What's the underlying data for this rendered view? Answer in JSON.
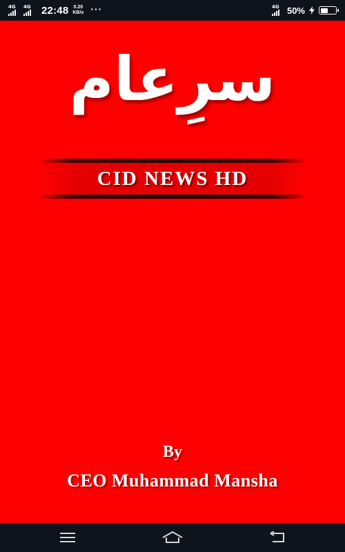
{
  "status_bar": {
    "network1": "4G",
    "network2": "4G",
    "time": "22:48",
    "speed_value": "0.20",
    "speed_unit": "KB/s",
    "more_dots": "···",
    "network3": "4G",
    "battery_percent": "50%",
    "battery_level": 0.5,
    "icons": [
      "signal-icon",
      "signal-icon",
      "more-icon",
      "signal-icon",
      "charging-icon",
      "battery-icon"
    ]
  },
  "splash": {
    "background_color": "#fe0000",
    "logo_text": "سرِعام",
    "banner_title": "CID NEWS HD",
    "credit_by": "By",
    "credit_name": "CEO Muhammad Mansha"
  },
  "nav_bar": {
    "buttons": [
      {
        "icon": "menu-icon"
      },
      {
        "icon": "home-icon"
      },
      {
        "icon": "back-icon"
      }
    ]
  }
}
